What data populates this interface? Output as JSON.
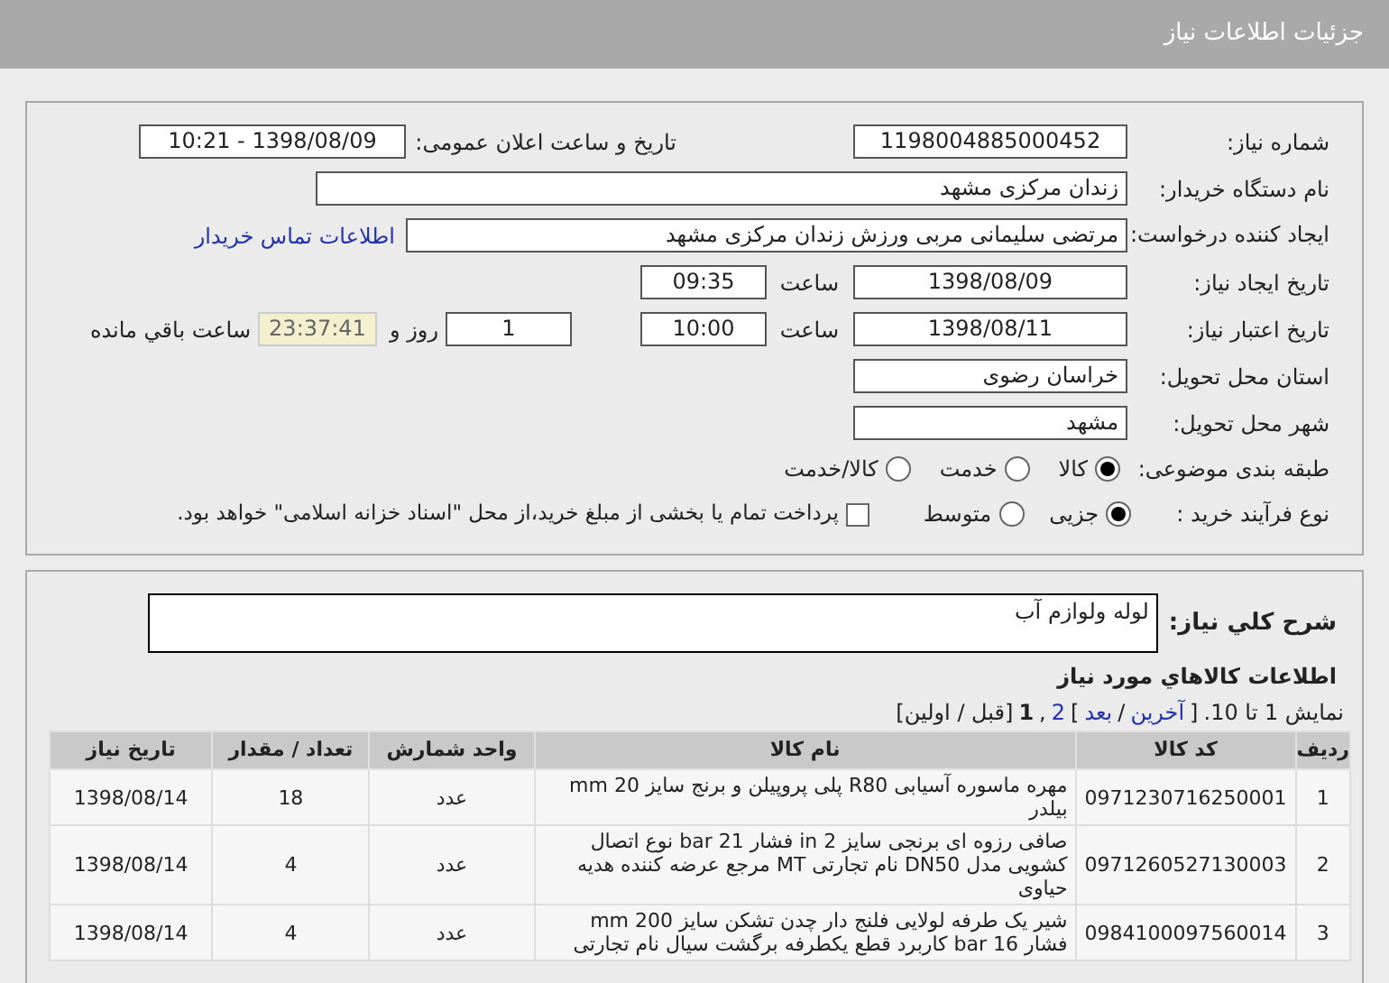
{
  "header": {
    "title": "جزئیات اطلاعات نیاز"
  },
  "form": {
    "need_number": {
      "label": "شماره نیاز:",
      "value": "1198004885000452"
    },
    "announce": {
      "label": "تاریخ و ساعت اعلان عمومی:",
      "value": "1398/08/09 - 10:21"
    },
    "buyer": {
      "label": "نام دستگاه خریدار:",
      "value": "زندان مرکزی مشهد"
    },
    "creator": {
      "label": "ایجاد کننده درخواست:",
      "value": "مرتضی سلیمانی مربی ورزش زندان مرکزی مشهد",
      "link": "اطلاعات تماس خریدار"
    },
    "created": {
      "label": "تاریخ ایجاد نیاز:",
      "date": "1398/08/09",
      "time_label": "ساعت",
      "time": "09:35"
    },
    "valid": {
      "label": "تاریخ اعتبار نیاز:",
      "date": "1398/08/11",
      "time_label": "ساعت",
      "time": "10:00",
      "days": "1",
      "days_label": "روز و",
      "remaining": "23:37:41",
      "remaining_label": "ساعت باقي مانده"
    },
    "province": {
      "label": "استان محل تحویل:",
      "value": "خراسان رضوی"
    },
    "city": {
      "label": "شهر محل تحویل:",
      "value": "مشهد"
    },
    "category": {
      "label": "طبقه بندی موضوعی:",
      "options": [
        {
          "label": "کالا",
          "selected": true
        },
        {
          "label": "خدمت",
          "selected": false
        },
        {
          "label": "کالا/خدمت",
          "selected": false
        }
      ]
    },
    "process": {
      "label": "نوع فرآیند خرید :",
      "options": [
        {
          "label": "جزیی",
          "selected": true
        },
        {
          "label": "متوسط",
          "selected": false
        }
      ],
      "payment": {
        "checked": false,
        "text": "پرداخت تمام یا بخشی از مبلغ خرید،از محل \"اسناد خزانه اسلامی\" خواهد بود."
      }
    }
  },
  "description": {
    "label": "شرح کلي نياز:",
    "value": "لوله ولوازم آب"
  },
  "goods": {
    "title": "اطلاعات کالاهاي مورد نياز",
    "pagination": [
      {
        "kind": "text",
        "text": "نمایش 1 تا 10."
      },
      {
        "kind": "text",
        "text": "["
      },
      {
        "kind": "link",
        "text": "آخرین"
      },
      {
        "kind": "text",
        "text": "/"
      },
      {
        "kind": "link",
        "text": "بعد"
      },
      {
        "kind": "text",
        "text": "]"
      },
      {
        "kind": "link",
        "text": "2"
      },
      {
        "kind": "text",
        "text": ","
      },
      {
        "kind": "current",
        "text": "1"
      },
      {
        "kind": "text",
        "text": "[قبل / اولین]"
      }
    ],
    "columns": [
      "ردیف",
      "کد کالا",
      "نام کالا",
      "واحد شمارش",
      "تعداد / مقدار",
      "تاریخ نیاز"
    ],
    "rows": [
      [
        "1",
        "0971230716250001",
        "مهره ماسوره آسیابی R80 پلی پروپیلن و برنج سایز 20 mm بیلدر",
        "عدد",
        "18",
        "1398/08/14"
      ],
      [
        "2",
        "0971260527130003",
        "صافی رزوه ای برنجی سایز 2 in فشار 21 bar نوع اتصال کشویی مدل DN50 نام تجارتی MT مرجع عرضه کننده هدیه حیاوی",
        "عدد",
        "4",
        "1398/08/14"
      ],
      [
        "3",
        "0984100097560014",
        "شیر یک طرفه لولایی فلنج دار چدن تشکن سایز 200 mm فشار 16 bar کاربرد قطع یکطرفه برگشت سیال نام تجارتی",
        "عدد",
        "4",
        "1398/08/14"
      ]
    ]
  }
}
